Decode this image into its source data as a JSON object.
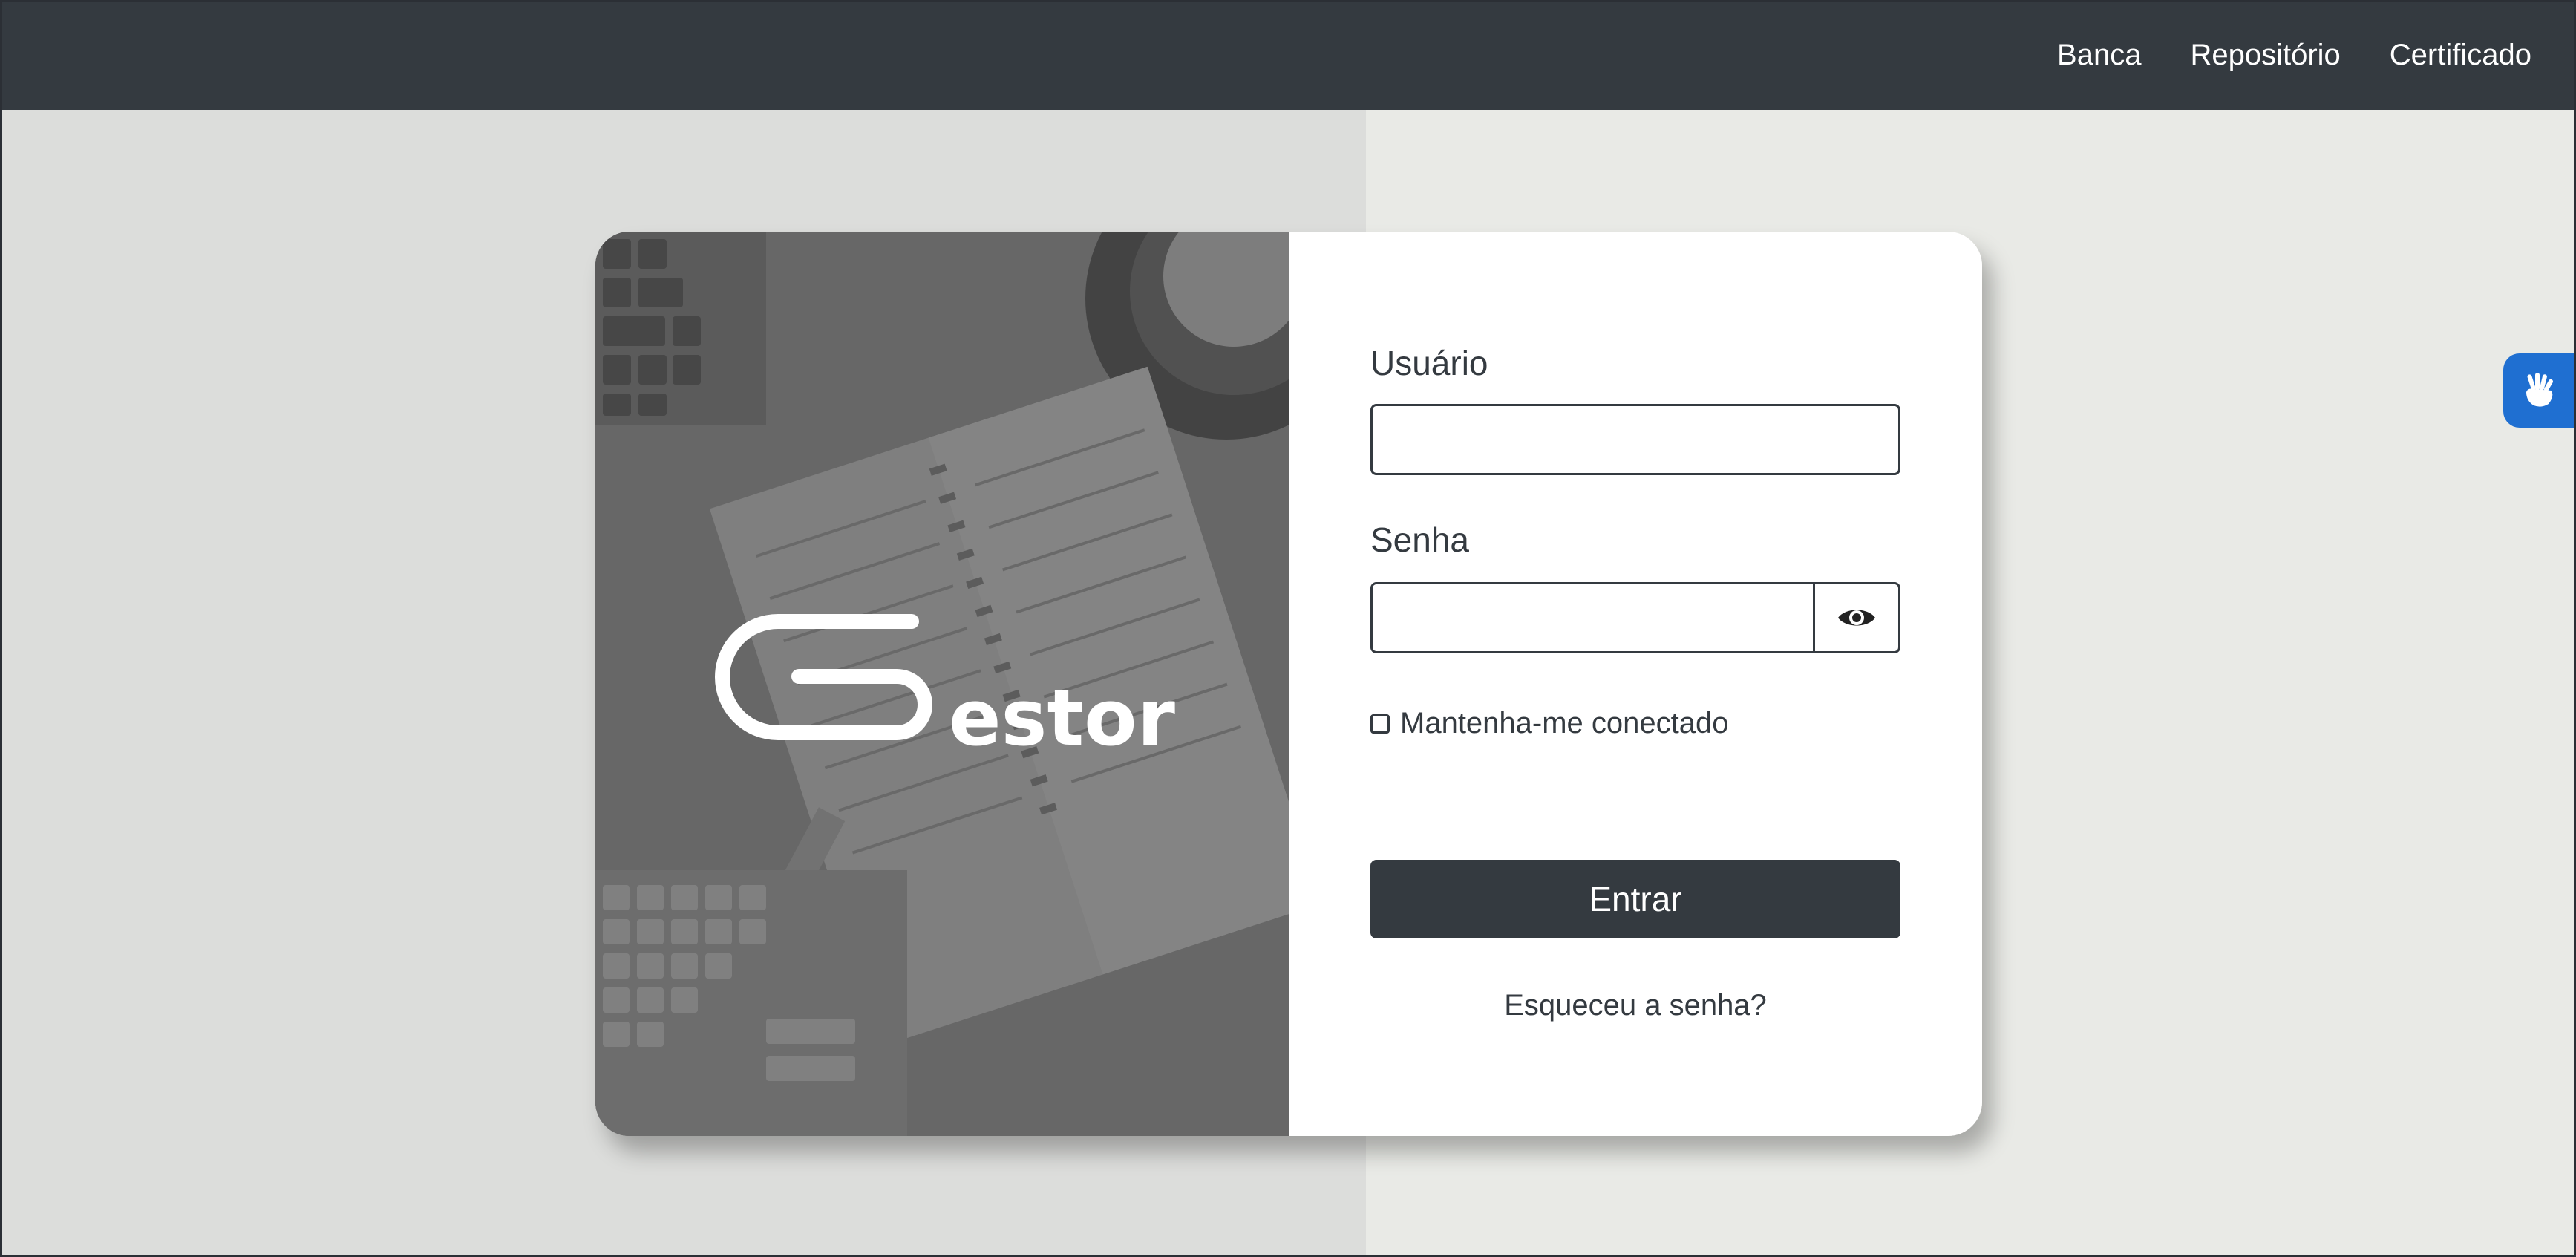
{
  "nav": {
    "items": [
      {
        "label": "Banca"
      },
      {
        "label": "Repositório"
      },
      {
        "label": "Certificado"
      }
    ]
  },
  "brand": {
    "logo_text": "estor",
    "logo_letter": "G"
  },
  "login": {
    "username_label": "Usuário",
    "username_value": "",
    "password_label": "Senha",
    "password_value": "",
    "remember_label": "Mantenha-me conectado",
    "remember_checked": false,
    "submit_label": "Entrar",
    "forgot_label": "Esqueceu a senha?"
  },
  "icons": {
    "password_toggle": "eye-icon",
    "accessibility": "sign-language-icon"
  },
  "colors": {
    "topbar": "#343a40",
    "button": "#343a40",
    "page_bg": "#e9eae6",
    "accessibility_accent": "#1f6fd1"
  }
}
